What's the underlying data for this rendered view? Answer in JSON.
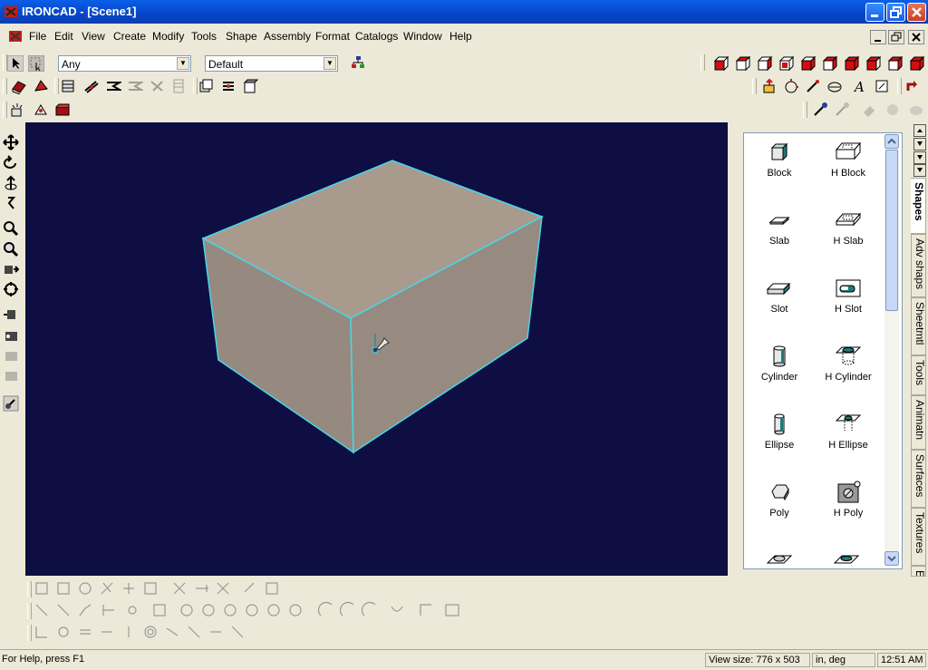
{
  "window": {
    "title": "IRONCAD - [Scene1]"
  },
  "menu": [
    "File",
    "Edit",
    "View",
    "Create",
    "Modify",
    "Tools",
    "Shape",
    "Assembly",
    "Format",
    "Catalogs",
    "Window",
    "Help"
  ],
  "toolbar": {
    "filter_value": "Any",
    "style_value": "Default"
  },
  "catalog": {
    "items": [
      {
        "label": "Block",
        "icon": "block-icon"
      },
      {
        "label": "H Block",
        "icon": "h-block-icon"
      },
      {
        "label": "Slab",
        "icon": "slab-icon"
      },
      {
        "label": "H Slab",
        "icon": "h-slab-icon"
      },
      {
        "label": "Slot",
        "icon": "slot-icon"
      },
      {
        "label": "H Slot",
        "icon": "h-slot-icon"
      },
      {
        "label": "Cylinder",
        "icon": "cylinder-icon"
      },
      {
        "label": "H Cylinder",
        "icon": "h-cylinder-icon"
      },
      {
        "label": "Ellipse",
        "icon": "ellipse-icon"
      },
      {
        "label": "H Ellipse",
        "icon": "h-ellipse-icon"
      },
      {
        "label": "Poly",
        "icon": "poly-icon"
      },
      {
        "label": "H Poly",
        "icon": "h-poly-icon"
      }
    ],
    "tabs": [
      "Shapes",
      "Adv shaps",
      "Sheetmtl",
      "Tools",
      "Animatn",
      "Surfaces",
      "Textures",
      "E"
    ]
  },
  "status": {
    "help": "For Help, press F1",
    "view_size": "View size:  776 x  503",
    "units": "in, deg",
    "time": "12:51 AM"
  },
  "colors": {
    "viewport_bg": "#0e0e42",
    "block_face": "#a89a8e",
    "edge": "#40d8e8",
    "titlebar": "#0546c8"
  }
}
